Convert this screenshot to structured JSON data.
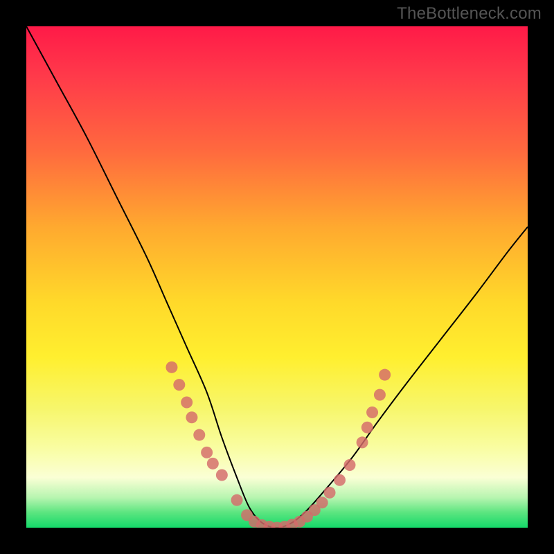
{
  "watermark": "TheBottleneck.com",
  "chart_data": {
    "type": "line",
    "title": "",
    "xlabel": "",
    "ylabel": "",
    "xlim": [
      0,
      100
    ],
    "ylim": [
      0,
      100
    ],
    "grid": false,
    "legend": false,
    "background_gradient": [
      "#ff1a48",
      "#ff6a3e",
      "#ffd92a",
      "#f7f66a",
      "#b7f5b0",
      "#14d96a"
    ],
    "series": [
      {
        "name": "bottleneck-curve",
        "x": [
          0,
          6,
          12,
          18,
          24,
          28,
          32,
          36,
          39,
          42,
          44.5,
          47,
          50,
          53,
          56,
          60,
          65,
          70,
          76,
          83,
          90,
          96,
          100
        ],
        "values": [
          100,
          89,
          78,
          66,
          54,
          45,
          36,
          27,
          18,
          10,
          4,
          1,
          0,
          1,
          3.5,
          8,
          14,
          21,
          29,
          38,
          47,
          55,
          60
        ]
      }
    ],
    "markers": [
      {
        "x": 29.0,
        "y": 32.0
      },
      {
        "x": 30.5,
        "y": 28.5
      },
      {
        "x": 32.0,
        "y": 25.0
      },
      {
        "x": 33.0,
        "y": 22.0
      },
      {
        "x": 34.5,
        "y": 18.5
      },
      {
        "x": 36.0,
        "y": 15.0
      },
      {
        "x": 37.2,
        "y": 12.8
      },
      {
        "x": 39.0,
        "y": 10.5
      },
      {
        "x": 42.0,
        "y": 5.5
      },
      {
        "x": 44.0,
        "y": 2.5
      },
      {
        "x": 45.5,
        "y": 1.2
      },
      {
        "x": 47.0,
        "y": 0.5
      },
      {
        "x": 48.5,
        "y": 0.2
      },
      {
        "x": 50.0,
        "y": 0.0
      },
      {
        "x": 51.5,
        "y": 0.2
      },
      {
        "x": 53.0,
        "y": 0.6
      },
      {
        "x": 54.5,
        "y": 1.2
      },
      {
        "x": 56.0,
        "y": 2.2
      },
      {
        "x": 57.5,
        "y": 3.5
      },
      {
        "x": 59.0,
        "y": 5.0
      },
      {
        "x": 60.5,
        "y": 7.0
      },
      {
        "x": 62.5,
        "y": 9.5
      },
      {
        "x": 64.5,
        "y": 12.5
      },
      {
        "x": 67.0,
        "y": 17.0
      },
      {
        "x": 68.0,
        "y": 20.0
      },
      {
        "x": 69.0,
        "y": 23.0
      },
      {
        "x": 70.5,
        "y": 26.5
      },
      {
        "x": 71.5,
        "y": 30.5
      }
    ]
  }
}
